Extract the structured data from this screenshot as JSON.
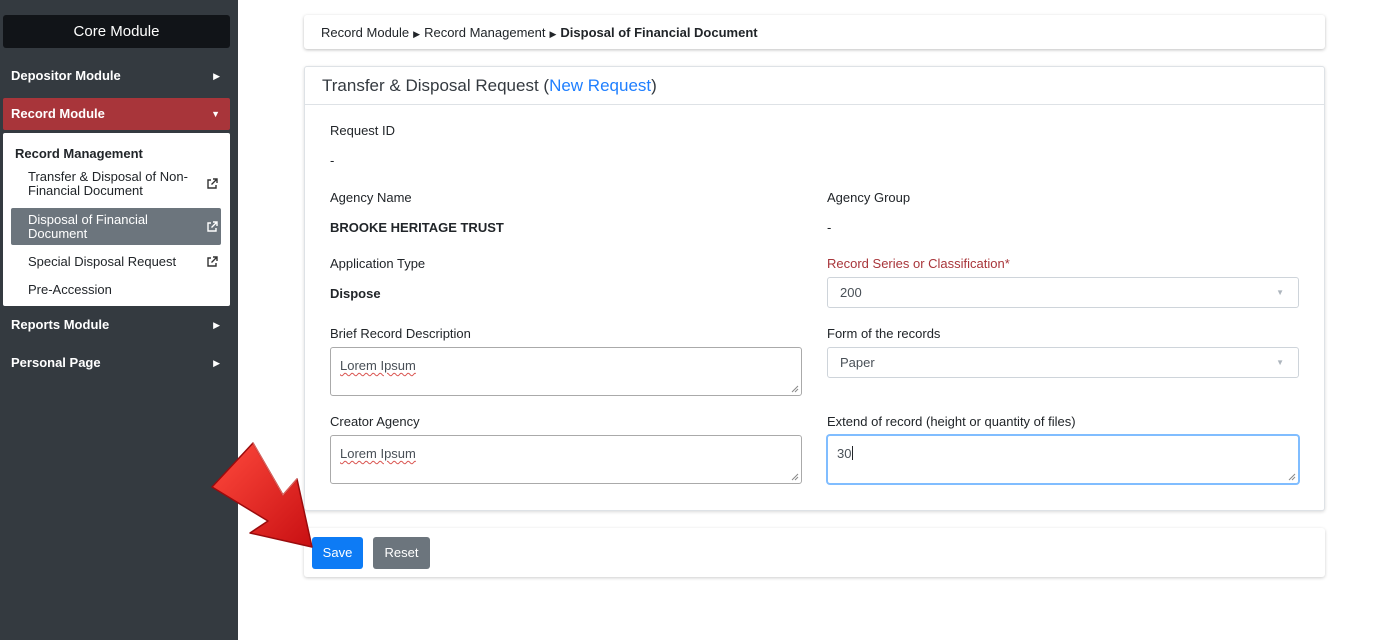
{
  "sidebar": {
    "header": "Core Module",
    "items": [
      {
        "label": "Depositor Module"
      },
      {
        "label": "Record Module"
      },
      {
        "label": "Reports Module"
      },
      {
        "label": "Personal Page"
      }
    ],
    "submenu": {
      "title": "Record Management",
      "links": [
        {
          "label_line1": "Transfer & Disposal of Non-",
          "label_line2": "Financial Document"
        },
        {
          "label_line1": "Disposal of Financial",
          "label_line2": "Document"
        },
        {
          "label": "Special Disposal Request"
        },
        {
          "label": "Pre-Accession"
        }
      ]
    }
  },
  "breadcrumb": {
    "crumb1": "Record Module",
    "crumb2": "Record Management",
    "current": "Disposal of Financial Document"
  },
  "form": {
    "title_prefix": "Transfer & Disposal Request (",
    "title_accent": "New Request",
    "title_suffix": ")",
    "request_id_label": "Request ID",
    "request_id_value": "-",
    "agency_name_label": "Agency Name",
    "agency_name_value": "BROOKE HERITAGE TRUST",
    "agency_group_label": "Agency Group",
    "agency_group_value": "-",
    "application_type_label": "Application Type",
    "application_type_value": "Dispose",
    "record_series_label": "Record Series or Classification*",
    "record_series_value": "200",
    "brief_description_label": "Brief Record Description",
    "brief_description_value": "Lorem Ipsum",
    "form_of_records_label": "Form of the records",
    "form_of_records_value": "Paper",
    "creator_agency_label": "Creator Agency",
    "creator_agency_value": "Lorem Ipsum",
    "extend_label": "Extend of record (height or quantity of files)",
    "extend_value": "30"
  },
  "actions": {
    "save": "Save",
    "reset": "Reset"
  },
  "colors": {
    "sidebar_bg": "#343a40",
    "active_module": "#a8353a",
    "primary": "#0d7bf5",
    "secondary": "#6c757d",
    "arrow": "#e8191c"
  }
}
